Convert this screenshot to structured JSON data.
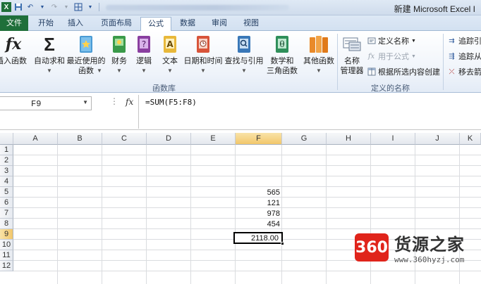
{
  "window": {
    "title": "新建 Microsoft Excel I"
  },
  "tabs": [
    "文件",
    "开始",
    "插入",
    "页面布局",
    "公式",
    "数据",
    "审阅",
    "视图"
  ],
  "ribbon": {
    "insert_function": {
      "line1": "插入函数"
    },
    "autosum": {
      "line1": "自动求和"
    },
    "recent": {
      "line1": "最近使用的",
      "line2": "函数"
    },
    "financial": {
      "line1": "财务"
    },
    "logical": {
      "line1": "逻辑"
    },
    "text": {
      "line1": "文本"
    },
    "datetime": {
      "line1": "日期和时间"
    },
    "lookup": {
      "line1": "查找与引用"
    },
    "mathtrig": {
      "line1": "数学和",
      "line2": "三角函数"
    },
    "more": {
      "line1": "其他函数"
    },
    "group_library": "函数库",
    "name_manager": {
      "line1": "名称",
      "line2": "管理器"
    },
    "define_name": "定义名称",
    "use_in_formula": "用于公式",
    "create_from_selection": "根据所选内容创建",
    "group_names": "定义的名称",
    "trace_precedents": "追踪引",
    "trace_dependents": "追踪从",
    "remove_arrows": "移去箭"
  },
  "formula_bar": {
    "name_box": "F9",
    "fx": "fx",
    "formula": "=SUM(F5:F8)"
  },
  "columns": [
    "A",
    "B",
    "C",
    "D",
    "E",
    "F",
    "G",
    "H",
    "I",
    "J",
    "K"
  ],
  "rows": [
    "1",
    "2",
    "3",
    "4",
    "5",
    "6",
    "7",
    "8",
    "9",
    "10",
    "11",
    "12"
  ],
  "cells": {
    "F5": "565",
    "F6": "121",
    "F7": "978",
    "F8": "454",
    "F9": "2118.00"
  },
  "watermark": {
    "logo": "360",
    "name": "货源之家",
    "url": "www.360hyzj.com"
  },
  "colors": {
    "file_tab": "#1f6f3a",
    "selection_header": "#f2c76b",
    "watermark_red": "#e0241b"
  }
}
